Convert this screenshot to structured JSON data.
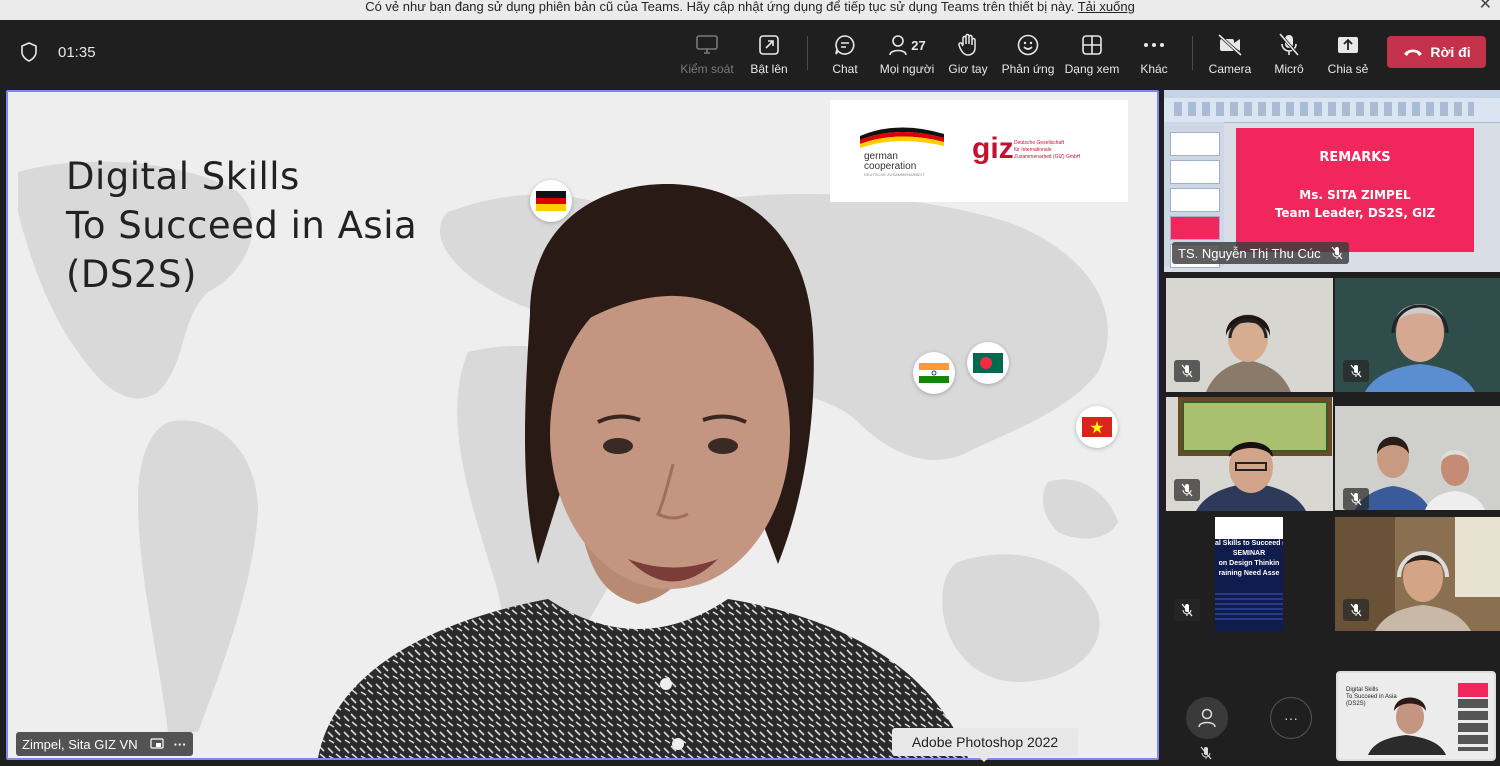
{
  "banner": {
    "message": "Có vẻ như bạn đang sử dụng phiên bản cũ của Teams. Hãy cập nhật ứng dụng để tiếp tục sử dụng Teams trên thiết bị này.",
    "link": "Tải xuống"
  },
  "toolbar": {
    "timer": "01:35",
    "control_label": "Kiểm soát",
    "popout_label": "Bật lên",
    "chat_label": "Chat",
    "people_label": "Mọi người",
    "people_count": "27",
    "raise_hand_label": "Giơ tay",
    "react_label": "Phản ứng",
    "view_label": "Dạng xem",
    "more_label": "Khác",
    "camera_label": "Camera",
    "mic_label": "Micrô",
    "share_label": "Chia sẻ",
    "leave_label": "Rời đi"
  },
  "stage": {
    "slide_title_1": "Digital Skills",
    "slide_title_2": "To Succeed in Asia",
    "slide_title_3": "(DS2S)",
    "german_logo_1": "german",
    "german_logo_2": "cooperation",
    "german_logo_3": "DEUTSCHE ZUSAMMENARBEIT",
    "giz_logo": "giz",
    "giz_text_1": "Deutsche Gesellschaft",
    "giz_text_2": "für Internationale",
    "giz_text_3": "Zusammenarbeit (GIZ) GmbH",
    "speaker_name": "Zimpel, Sita GIZ VN",
    "tooltip": "Adobe Photoshop 2022"
  },
  "shared_screen": {
    "slide_line_1": "REMARKS",
    "slide_line_2": "Ms. SITA ZIMPEL",
    "slide_line_3": "Team Leader, DS2S, GIZ",
    "presenter_name": "TS. Nguyễn Thị Thu Cúc"
  },
  "participant_slide": {
    "line_1": "al Skills to Succeed (",
    "line_2": "SEMINAR",
    "line_3": "on Design Thinkin",
    "line_4": "raining Need Asse"
  },
  "self_view": {
    "line_1": "Digital Skills",
    "line_2": "To Succeed in Asia",
    "line_3": "(DS2S)"
  },
  "colors": {
    "accent": "#7f85f5",
    "leave": "#c4314b",
    "slide_pink": "#f0265c"
  }
}
